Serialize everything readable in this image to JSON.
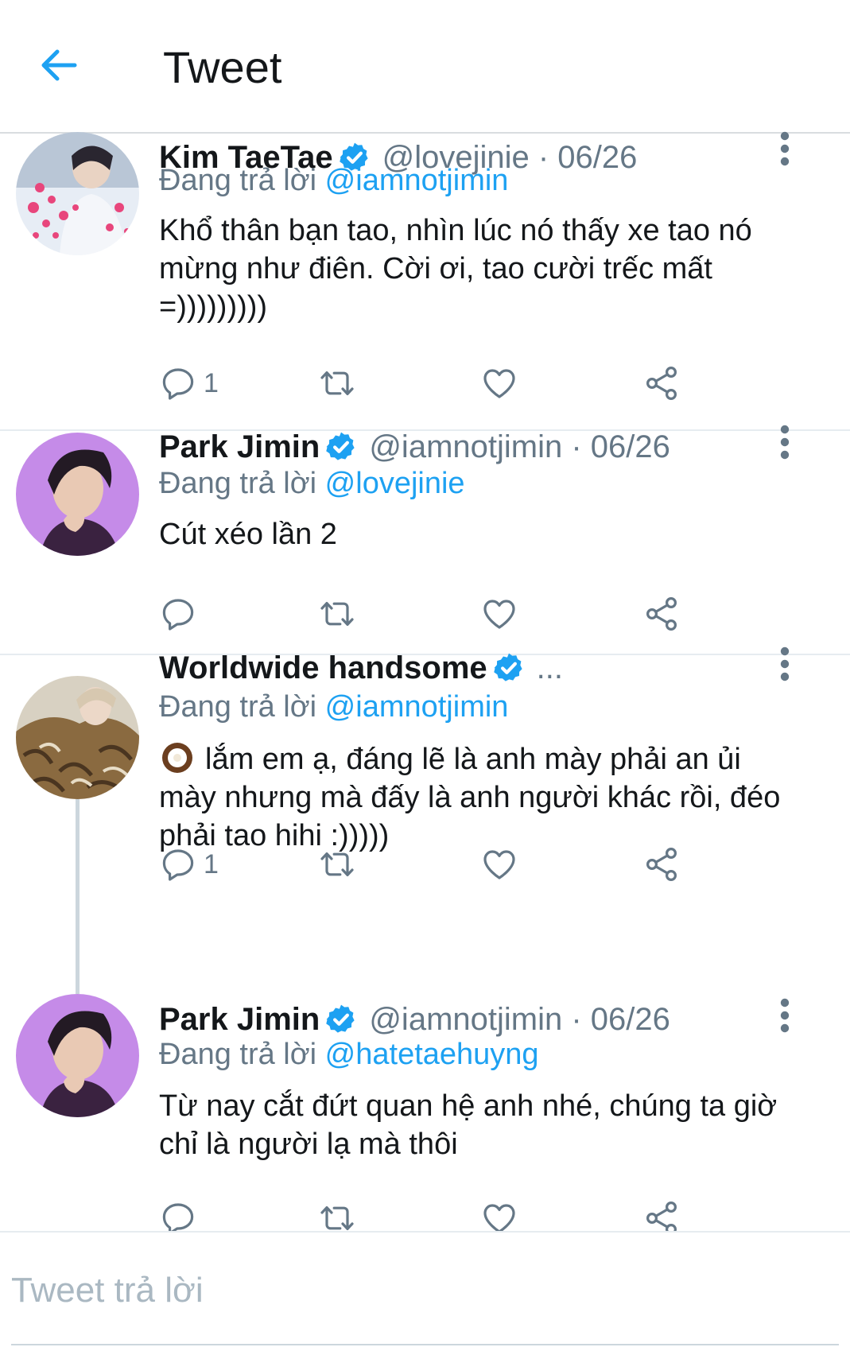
{
  "header": {
    "title": "Tweet"
  },
  "tweets": [
    {
      "name": "Kim TaeTae",
      "handle_date": "@lovejinie · 06/26",
      "reply_prefix": "Đang trả lời",
      "reply_to": "@iamnotjimin",
      "text": "Khổ thân bạn tao, nhìn lúc nó thấy xe tao nó mừng như điên. Cời ơi, tao cười trếc mất =)))))))))",
      "reply_count": "1"
    },
    {
      "name": "Park Jimin",
      "handle_date": "@iamnotjimin · 06/26",
      "reply_prefix": "Đang trả lời",
      "reply_to": "@lovejinie",
      "text": "Cút xéo lần 2",
      "reply_count": ""
    },
    {
      "name": "Worldwide handsome",
      "handle_date": "...",
      "reply_prefix": "Đang trả lời",
      "reply_to": "@iamnotjimin",
      "text": "lắm em ạ, đáng lẽ là anh mày phải an ủi mày nhưng mà đấy là anh người khác rồi, đéo phải tao hihi :)))))",
      "emoji": "coconut",
      "reply_count": "1"
    },
    {
      "name": "Park Jimin",
      "handle_date": "@iamnotjimin · 06/26",
      "reply_prefix": "Đang trả lời",
      "reply_to": "@hatetaehuyng",
      "text": "Từ nay cắt đứt quan hệ anh nhé, chúng ta giờ chỉ là người lạ mà thôi",
      "reply_count": ""
    }
  ],
  "compose": {
    "placeholder": "Tweet trả lời"
  },
  "colors": {
    "accent": "#1da1f2",
    "text": "#14171a",
    "secondary": "#657786"
  },
  "icons": [
    "back-arrow-icon",
    "verified-badge-icon",
    "more-vertical-icon",
    "reply-icon",
    "retweet-icon",
    "like-icon",
    "share-icon"
  ]
}
